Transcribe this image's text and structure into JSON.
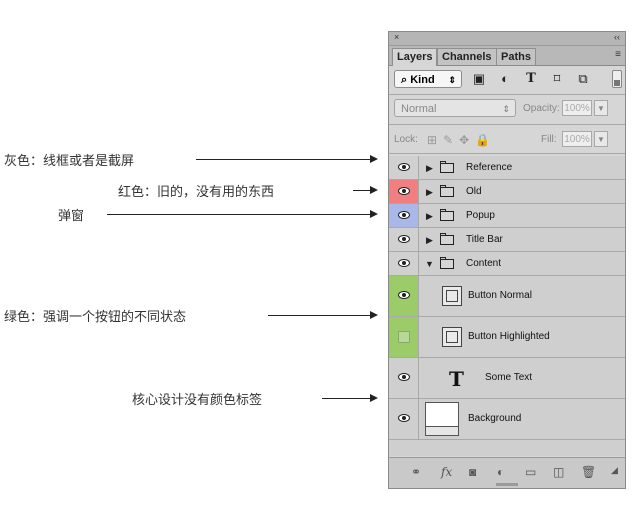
{
  "annotations": {
    "gray": "灰色：线框或者是截屏",
    "red": "红色：旧的，没有用的东西",
    "popup": "弹窗",
    "green": "绿色：强调一个按钮的不同状态",
    "core": "核心设计没有颜色标签"
  },
  "panel": {
    "close_glyph": "×",
    "collapse_glyph": "‹‹",
    "tabs": [
      "Layers",
      "Channels",
      "Paths"
    ],
    "menu_glyph": "≡",
    "filter": {
      "kind_label": "Kind",
      "sort_glyph": "⇕"
    },
    "blend": {
      "mode": "Normal",
      "opacity_label": "Opacity:",
      "opacity_value": "100%"
    },
    "lock": {
      "label": "Lock:",
      "fill_label": "Fill:",
      "fill_value": "100%"
    },
    "layers": [
      {
        "name": "Reference",
        "color": "gray",
        "visible": true,
        "type": "group-collapsed"
      },
      {
        "name": "Old",
        "color": "red",
        "visible": true,
        "type": "group-collapsed"
      },
      {
        "name": "Popup",
        "color": "blue",
        "visible": true,
        "type": "group-collapsed"
      },
      {
        "name": "Title Bar",
        "color": "gray",
        "visible": true,
        "type": "group-collapsed"
      },
      {
        "name": "Content",
        "color": "gray",
        "visible": true,
        "type": "group-expanded"
      },
      {
        "name": "Button Normal",
        "color": "green",
        "visible": true,
        "type": "artboard"
      },
      {
        "name": "Button Highlighted",
        "color": "green",
        "visible": false,
        "type": "artboard"
      },
      {
        "name": "Some Text",
        "color": "none",
        "visible": true,
        "type": "text"
      },
      {
        "name": "Background",
        "color": "none",
        "visible": true,
        "type": "image"
      }
    ]
  },
  "colors": {
    "gray": "#d0d0d0",
    "red": "#f08080",
    "blue": "#a9b8e8",
    "green": "#9ccc6a"
  }
}
